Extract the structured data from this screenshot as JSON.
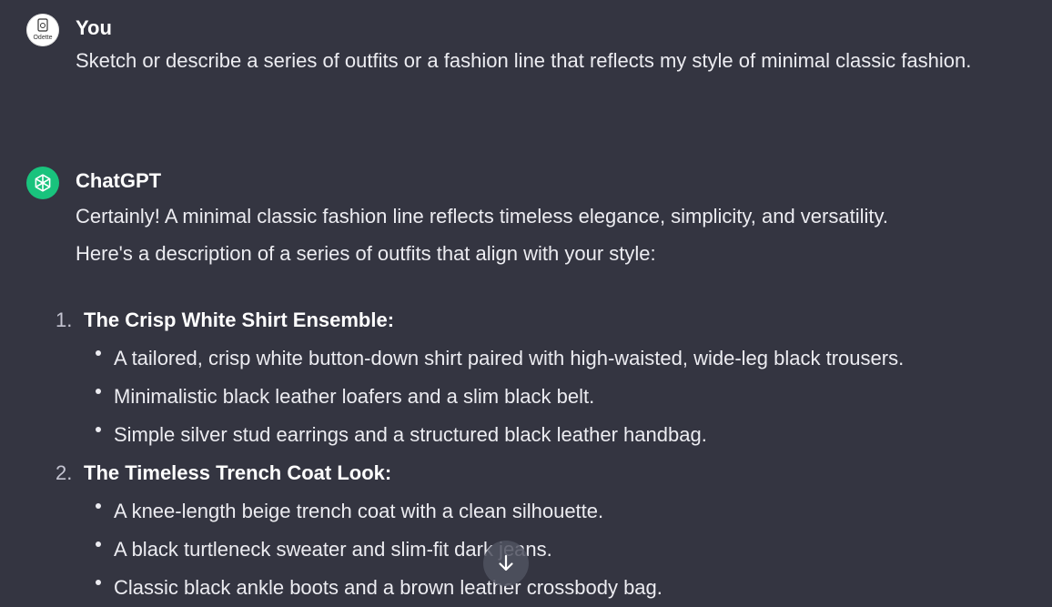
{
  "conversation": {
    "user_message": {
      "author": "You",
      "avatar_text": "Odette",
      "text": "Sketch or describe a series of outfits or a fashion line that reflects my style of minimal classic fashion."
    },
    "assistant_message": {
      "author": "ChatGPT",
      "intro_1": "Certainly! A minimal classic fashion line reflects timeless elegance, simplicity, and versatility.",
      "intro_2": "Here's a description of a series of outfits that align with your style:",
      "items": [
        {
          "number": "1.",
          "title": "The Crisp White Shirt Ensemble:",
          "bullets": [
            "A tailored, crisp white button-down shirt paired with high-waisted, wide-leg black trousers.",
            "Minimalistic black leather loafers and a slim black belt.",
            "Simple silver stud earrings and a structured black leather handbag."
          ]
        },
        {
          "number": "2.",
          "title": "The Timeless Trench Coat Look:",
          "bullets": [
            "A knee-length beige trench coat with a clean silhouette.",
            "A black turtleneck sweater and slim-fit dark jeans.",
            "Classic black ankle boots and a brown leather crossbody bag."
          ]
        }
      ]
    }
  },
  "icons": {
    "assistant_avatar": "openai-logo-icon",
    "scroll_button": "arrow-down-icon"
  },
  "colors": {
    "background": "#343541",
    "assistant_avatar_bg": "#19c37d",
    "text": "#ececf1"
  }
}
